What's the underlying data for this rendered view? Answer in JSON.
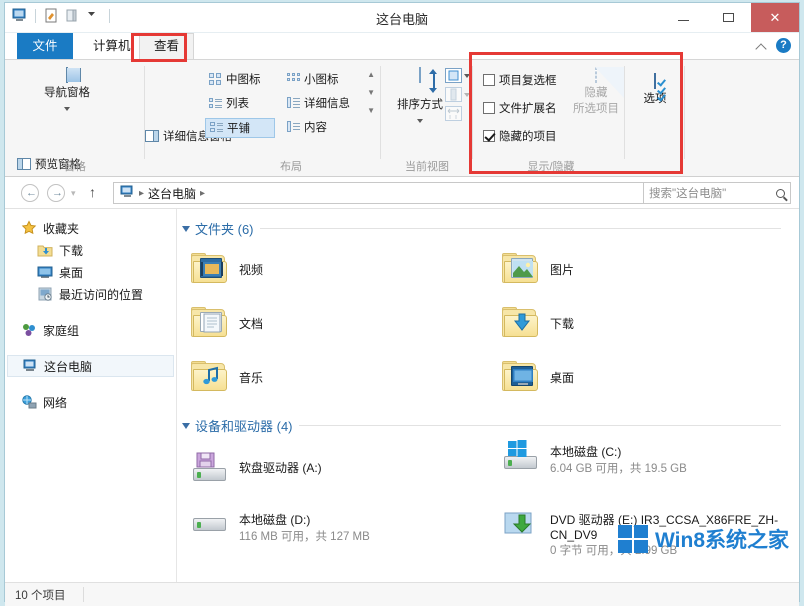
{
  "window": {
    "title": "这台电脑",
    "quick_access": [
      "this-pc-icon",
      "properties-icon",
      "new-folder-icon",
      "customize-dropdown"
    ],
    "controls": {
      "minimize": "–",
      "maximize": "□",
      "close": "✕"
    }
  },
  "tabs": [
    {
      "id": "file",
      "label": "文件"
    },
    {
      "id": "computer",
      "label": "计算机"
    },
    {
      "id": "view",
      "label": "查看"
    }
  ],
  "ribbon_right": {
    "collapse": "chevron-up-icon",
    "help": "?"
  },
  "ribbon": {
    "panes_group": {
      "label": "窗格",
      "navigation_pane": "导航窗格",
      "preview_pane": "预览窗格",
      "details_pane": "详细信息窗格"
    },
    "layout_group": {
      "label": "布局",
      "items": [
        {
          "label": "中图标",
          "selected": false
        },
        {
          "label": "小图标",
          "selected": false
        },
        {
          "label": "列表",
          "selected": false
        },
        {
          "label": "详细信息",
          "selected": false
        },
        {
          "label": "平铺",
          "selected": true
        },
        {
          "label": "内容",
          "selected": false
        }
      ]
    },
    "current_view_group": {
      "label": "当前视图",
      "sort_by": "排序方式"
    },
    "show_hide_group": {
      "label": "显示/隐藏",
      "checkboxes": [
        {
          "label": "项目复选框",
          "checked": false
        },
        {
          "label": "文件扩展名",
          "checked": false
        },
        {
          "label": "隐藏的项目",
          "checked": true
        }
      ],
      "hide_selected_line1": "隐藏",
      "hide_selected_line2": "所选项目"
    },
    "options_group": {
      "options": "选项"
    }
  },
  "address_bar": {
    "back": "←",
    "forward": "→",
    "recent": "▾",
    "up": "↑",
    "breadcrumb": [
      "这台电脑"
    ],
    "separator": "▸",
    "dropdown": "⌄",
    "refresh": "↻",
    "search_placeholder": "搜索\"这台电脑\""
  },
  "sidebar": {
    "items": [
      {
        "label": "收藏夹",
        "icon": "star-icon",
        "level": 0,
        "selected": false
      },
      {
        "label": "下载",
        "icon": "downloads-folder-icon",
        "level": 1,
        "selected": false
      },
      {
        "label": "桌面",
        "icon": "desktop-icon",
        "level": 1,
        "selected": false
      },
      {
        "label": "最近访问的位置",
        "icon": "recent-places-icon",
        "level": 1,
        "selected": false
      },
      {
        "label": "家庭组",
        "icon": "homegroup-icon",
        "level": 0,
        "selected": false
      },
      {
        "label": "这台电脑",
        "icon": "this-pc-icon",
        "level": 0,
        "selected": true
      },
      {
        "label": "网络",
        "icon": "network-icon",
        "level": 0,
        "selected": false
      }
    ]
  },
  "content": {
    "folders_section": {
      "title": "文件夹 (6)",
      "items": [
        {
          "label": "视频",
          "icon": "videos-folder-icon"
        },
        {
          "label": "图片",
          "icon": "pictures-folder-icon"
        },
        {
          "label": "文档",
          "icon": "documents-folder-icon"
        },
        {
          "label": "下载",
          "icon": "downloads-folder-icon"
        },
        {
          "label": "音乐",
          "icon": "music-folder-icon"
        },
        {
          "label": "桌面",
          "icon": "desktop-folder-icon"
        }
      ]
    },
    "drives_section": {
      "title": "设备和驱动器 (4)",
      "items": [
        {
          "name": "软盘驱动器 (A:)",
          "icon": "floppy-drive-icon",
          "has_bar": false,
          "free_text": "",
          "used_percent": 0
        },
        {
          "name": "本地磁盘 (C:)",
          "icon": "windows-drive-icon",
          "has_bar": true,
          "free_text": "6.04 GB 可用，共 19.5 GB",
          "used_percent": 69
        },
        {
          "name": "本地磁盘 (D:)",
          "icon": "hard-drive-icon",
          "has_bar": true,
          "free_text": "116 MB 可用，共 127 MB",
          "used_percent": 9
        },
        {
          "name": "DVD 驱动器 (E:)",
          "icon": "dvd-drive-icon",
          "volume_label": "IR3_CCSA_X86FRE_ZH-CN_DV9",
          "has_bar": false,
          "free_text": "0 字节 可用，共 2.99 GB",
          "used_percent": 100
        }
      ]
    }
  },
  "status_bar": {
    "item_count": "10 个项目"
  },
  "watermark": {
    "text": "Win8系统之家"
  },
  "colors": {
    "accent": "#1a7bc4",
    "highlight_box": "#e53935",
    "bar_fill": "#1f9ae0",
    "close_button": "#c75c5c",
    "section_title": "#2b6ca8"
  }
}
